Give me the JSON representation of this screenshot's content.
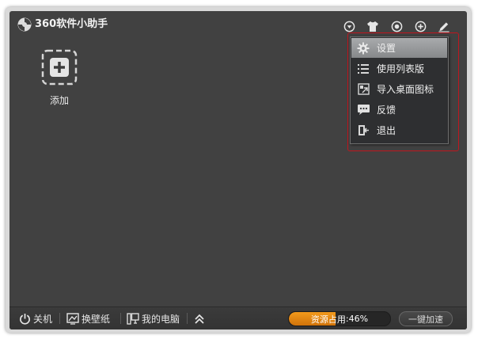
{
  "app": {
    "title": "360软件小助手"
  },
  "titlebar_icons": [
    "menu-dropdown-icon",
    "tshirt-skin-icon",
    "record-circle-icon",
    "plus-box-icon",
    "pencil-edit-icon"
  ],
  "main": {
    "add_label": "添加"
  },
  "menu": {
    "items": [
      {
        "label": "设置",
        "icon": "gear-icon"
      },
      {
        "label": "使用列表版",
        "icon": "list-icon"
      },
      {
        "label": "导入桌面图标",
        "icon": "import-icon"
      },
      {
        "label": "反馈",
        "icon": "feedback-bubble-icon"
      },
      {
        "label": "退出",
        "icon": "exit-icon"
      }
    ],
    "highlight_color": "#c0161e"
  },
  "bottombar": {
    "shutdown": "关机",
    "wallpaper": "换壁纸",
    "my_computer": "我的电脑",
    "usage_label": "资源占用",
    "usage_value": ":46%",
    "usage_fraction": 0.46,
    "boost": "一键加速"
  },
  "colors": {
    "background": "#414141",
    "accent": "#e8860f"
  }
}
